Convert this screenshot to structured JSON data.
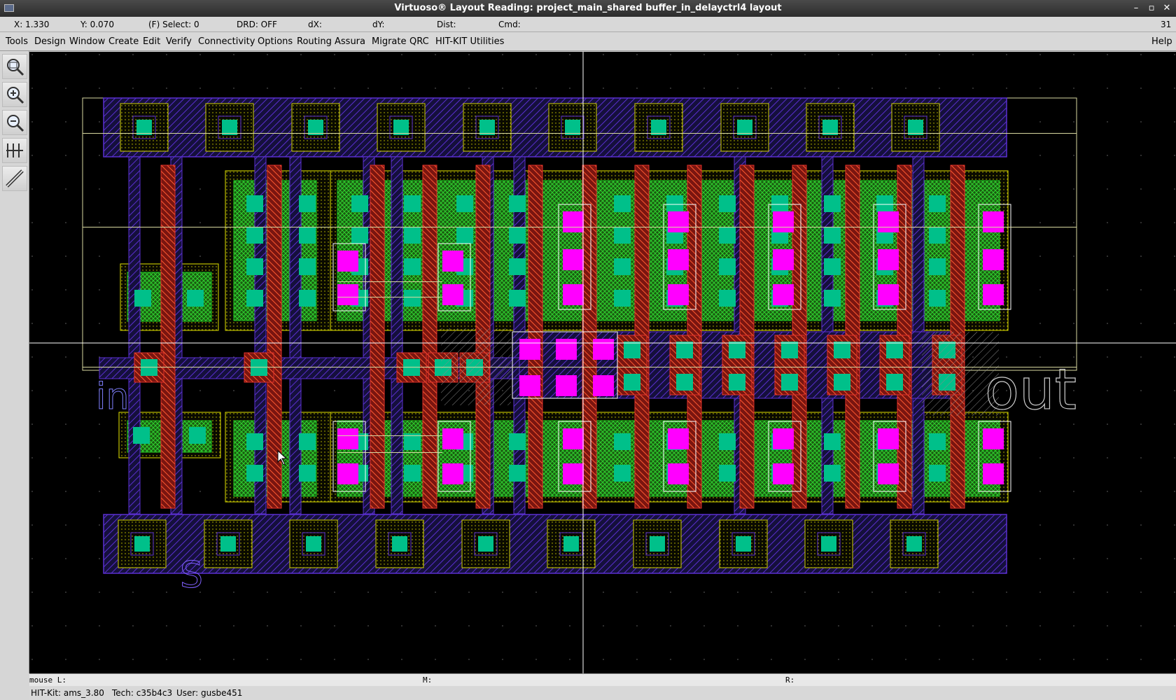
{
  "window": {
    "title": "Virtuoso® Layout Reading: project_main_shared buffer_in_delayctrl4 layout",
    "min_glyph": "–",
    "max_glyph": "▫",
    "close_glyph": "✕"
  },
  "coords": {
    "x": "X: 1.330",
    "y": "Y: 0.070",
    "select": "(F) Select: 0",
    "drd": "DRD: OFF",
    "dx": "dX:",
    "dy": "dY:",
    "dist": "Dist:",
    "cmd": "Cmd:",
    "num": "31"
  },
  "menu": {
    "items": [
      "Tools",
      "Design",
      "Window",
      "Create",
      "Edit",
      "Verify",
      "Connectivity",
      "Options",
      "Routing",
      "Assura",
      "Migrate",
      "QRC",
      "HIT-KIT Utilities"
    ],
    "help": "Help"
  },
  "toolbar": {
    "icons": [
      "fit-view-icon",
      "zoom-in-icon",
      "zoom-out-icon",
      "stretch-icon",
      "ruler-icon"
    ]
  },
  "layout": {
    "label_in": "in",
    "label_out": "out",
    "label_s": "S"
  },
  "mouse": {
    "l": "mouse L:",
    "m": "M:",
    "r": "R:"
  },
  "status": {
    "hitkit": "HIT-Kit: ams_3.80",
    "tech": "Tech: c35b4c3",
    "user": "User: gusbe451"
  },
  "colors": {
    "metal1": "#5a2fd0",
    "poly": "#e0302a",
    "diffusion": "#1fc01f",
    "contact": "#00c08a",
    "via": "#ff00ff",
    "well": "#e0e000",
    "cursor": "#ffffff"
  }
}
